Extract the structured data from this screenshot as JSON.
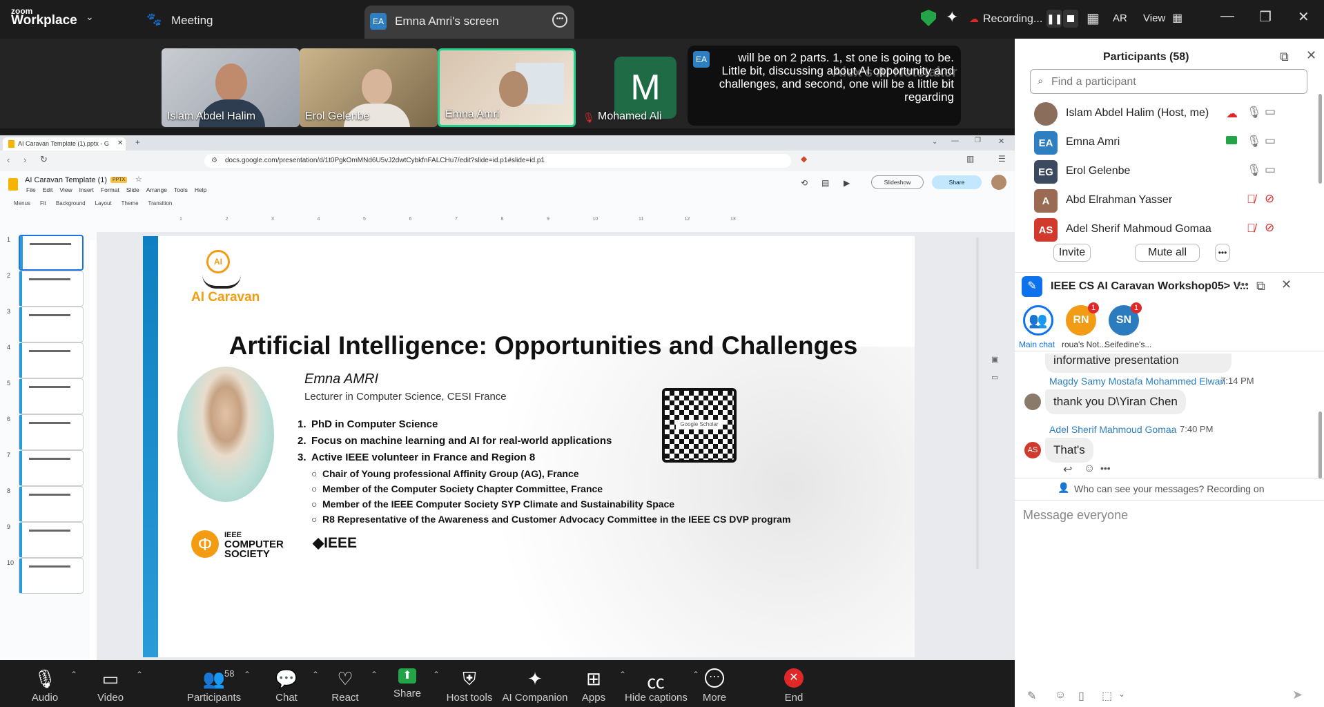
{
  "app": {
    "brand_top": "zoom",
    "brand_bottom": "Workplace",
    "meeting_label": "Meeting"
  },
  "share_tab": {
    "initials": "EA",
    "label": "Emna Amri's screen"
  },
  "top_right": {
    "recording": "Recording...",
    "ar": "AR",
    "view": "View"
  },
  "videos": [
    {
      "name": "Islam Abdel Halim"
    },
    {
      "name": "Erol Gelenbe"
    },
    {
      "name": "Emna Amri"
    },
    {
      "name": "Mohamed Ali",
      "initial": "M"
    }
  ],
  "captions": {
    "initials": "EA",
    "text": "will be on 2 parts. 1, st one is going to be. Little bit, discussing about AI opportunity and challenges, and second, one will be a little bit regarding",
    "bg_name": "Alex's AI Notetaker"
  },
  "browser": {
    "tab_title": "AI Caravan Template (1).pptx - G",
    "url": "docs.google.com/presentation/d/1t0PgkOmMNd6U5vJ2dwtCybkfnFALCHu7/edit?slide=id.p1#slide=id.p1"
  },
  "slides_app": {
    "doc_title": "AI Caravan Template (1)",
    "badge": "PPTX",
    "menus": [
      "File",
      "Edit",
      "View",
      "Insert",
      "Format",
      "Slide",
      "Arrange",
      "Tools",
      "Help"
    ],
    "toolbar": [
      "Menus",
      "Fit",
      "Background",
      "Layout",
      "Theme",
      "Transition"
    ],
    "slideshow": "Slideshow",
    "share": "Share",
    "ruler": [
      "1",
      "2",
      "3",
      "4",
      "5",
      "6",
      "7",
      "8",
      "9",
      "10",
      "11",
      "12",
      "13"
    ],
    "thumb_numbers": [
      "1",
      "2",
      "3",
      "4",
      "5",
      "6",
      "7",
      "8",
      "9",
      "10"
    ]
  },
  "slide": {
    "logo_text": "AI Caravan",
    "logo_badge": "AI",
    "title": "Artificial Intelligence: Opportunities and Challenges",
    "speaker": "Emna AMRI",
    "role": "Lecturer in Computer Science, CESI France",
    "items": [
      {
        "n": "1.",
        "text": "PhD in Computer Science"
      },
      {
        "n": "2.",
        "text": "Focus on machine learning and AI for real-world applications"
      },
      {
        "n": "3.",
        "text": "Active IEEE volunteer in France and Region 8"
      }
    ],
    "subitems": [
      "Chair of Young professional Affinity Group (AG), France",
      "Member of the Computer Society Chapter Committee, France",
      "Member of the IEEE Computer Society SYP Climate and Sustainability Space",
      "R8 Representative of the Awareness and Customer Advocacy Committee in the IEEE CS DVP program"
    ],
    "qr_label": "Google Scholar",
    "cs_logo": [
      "IEEE",
      "COMPUTER",
      "SOCIETY"
    ],
    "ieee_logo": "IEEE"
  },
  "participants": {
    "title": "Participants (58)",
    "search_placeholder": "Find a participant",
    "list": [
      {
        "name": "Islam Abdel Halim (Host, me)",
        "initials": "",
        "color": "#8a6d5a"
      },
      {
        "name": "Emna Amri",
        "initials": "EA",
        "color": "#2d7fc1"
      },
      {
        "name": "Erol Gelenbe",
        "initials": "EG",
        "color": "#3b4a5e"
      },
      {
        "name": "Abd Elrahman Yasser",
        "initials": "A",
        "color": "#9a6b52"
      },
      {
        "name": "Adel Sherif Mahmoud Gomaa",
        "initials": "AS",
        "color": "#d0392b"
      }
    ],
    "invite": "Invite",
    "mute_all": "Mute all"
  },
  "chat": {
    "title": "IEEE CS AI Caravan Workshop05> V...",
    "tabs": [
      {
        "label": "Main chat",
        "initials": "",
        "badge": ""
      },
      {
        "label": "roua's Not...",
        "initials": "RN",
        "badge": "1"
      },
      {
        "label": "Seifedine's...",
        "initials": "SN",
        "badge": "1"
      }
    ],
    "partial": "informative presentation",
    "messages": [
      {
        "sender": "Magdy Samy Mostafa Mohammed Elwan",
        "time": "7:14 PM",
        "text": "thank you D\\Yiran Chen",
        "initials": ""
      },
      {
        "sender": "Adel Sherif Mahmoud Gomaa",
        "time": "7:40 PM",
        "text": "That's",
        "initials": "AS"
      }
    ],
    "notice": "Who can see your messages? Recording on",
    "placeholder": "Message everyone"
  },
  "toolbar": [
    {
      "id": "audio",
      "label": "Audio",
      "icon": "mic-icon"
    },
    {
      "id": "video",
      "label": "Video",
      "icon": "camera-icon"
    },
    {
      "id": "participants",
      "label": "Participants",
      "icon": "people-icon",
      "count": "58"
    },
    {
      "id": "chat",
      "label": "Chat",
      "icon": "chat-icon"
    },
    {
      "id": "react",
      "label": "React",
      "icon": "heart-icon"
    },
    {
      "id": "share",
      "label": "Share",
      "icon": "share-screen-icon"
    },
    {
      "id": "host",
      "label": "Host tools",
      "icon": "shield-icon"
    },
    {
      "id": "ai",
      "label": "AI Companion",
      "icon": "sparkle-icon"
    },
    {
      "id": "apps",
      "label": "Apps",
      "icon": "apps-icon"
    },
    {
      "id": "captions",
      "label": "Hide captions",
      "icon": "cc-icon"
    },
    {
      "id": "more",
      "label": "More",
      "icon": "more-icon"
    },
    {
      "id": "end",
      "label": "End",
      "icon": "end-icon"
    }
  ],
  "colors": {
    "accent": "#0e72ed",
    "green": "#22a447",
    "danger": "#e02828",
    "logo_orange": "#f39c12"
  }
}
